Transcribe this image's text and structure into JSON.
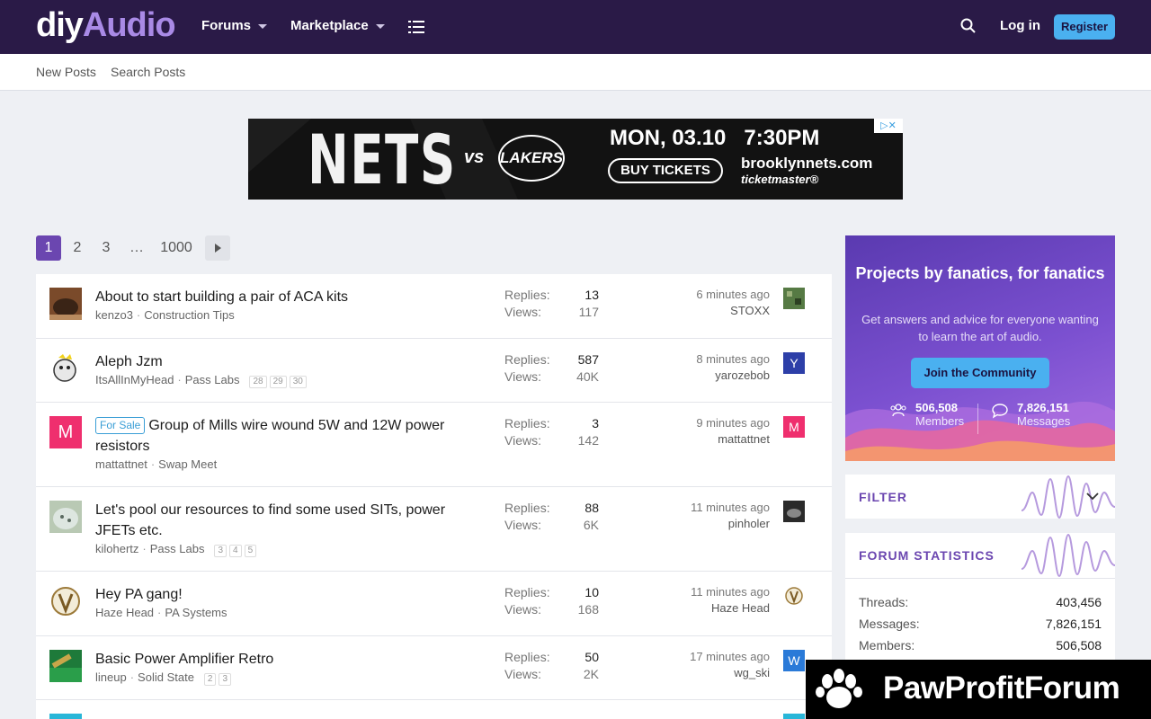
{
  "header": {
    "logo_part1": "diy",
    "logo_part2": "Audio",
    "nav": [
      "Forums",
      "Marketplace"
    ],
    "login": "Log in",
    "register": "Register"
  },
  "subnav": [
    "New Posts",
    "Search Posts"
  ],
  "ad": {
    "team": "NETS",
    "vs": "vs",
    "opponent": "LAKERS",
    "date": "MON, 03.10   7:30PM",
    "cta": "BUY TICKETS",
    "site": "brooklynnets.com",
    "vendor": "ticketmaster®"
  },
  "pagination": {
    "pages": [
      "1",
      "2",
      "3",
      "…",
      "1000"
    ],
    "current": "1"
  },
  "labels": {
    "replies": "Replies:",
    "views": "Views:"
  },
  "threads": [
    {
      "title": "About to start building a pair of ACA kits",
      "prefix": "",
      "author": "kenzo3",
      "forum": "Construction Tips",
      "pages": [],
      "replies": "13",
      "views": "117",
      "time": "6 minutes ago",
      "last_user": "STOXX",
      "last_avatar_letter": "",
      "avatar_letter": ""
    },
    {
      "title": "Aleph Jzm",
      "prefix": "",
      "author": "ItsAllInMyHead",
      "forum": "Pass Labs",
      "pages": [
        "28",
        "29",
        "30"
      ],
      "replies": "587",
      "views": "40K",
      "time": "8 minutes ago",
      "last_user": "yarozebob",
      "last_avatar_letter": "Y",
      "avatar_letter": ""
    },
    {
      "title": "Group of Mills wire wound 5W and 12W power resistors",
      "prefix": "For Sale",
      "author": "mattattnet",
      "forum": "Swap Meet",
      "pages": [],
      "replies": "3",
      "views": "142",
      "time": "9 minutes ago",
      "last_user": "mattattnet",
      "last_avatar_letter": "M",
      "avatar_letter": "M"
    },
    {
      "title": "Let's pool our resources to find some used SITs, power JFETs etc.",
      "prefix": "",
      "author": "kilohertz",
      "forum": "Pass Labs",
      "pages": [
        "3",
        "4",
        "5"
      ],
      "replies": "88",
      "views": "6K",
      "time": "11 minutes ago",
      "last_user": "pinholer",
      "last_avatar_letter": "",
      "avatar_letter": ""
    },
    {
      "title": "Hey PA gang!",
      "prefix": "",
      "author": "Haze Head",
      "forum": "PA Systems",
      "pages": [],
      "replies": "10",
      "views": "168",
      "time": "11 minutes ago",
      "last_user": "Haze Head",
      "last_avatar_letter": "",
      "avatar_letter": ""
    },
    {
      "title": "Basic Power Amplifier Retro",
      "prefix": "",
      "author": "lineup",
      "forum": "Solid State",
      "pages": [
        "2",
        "3"
      ],
      "replies": "50",
      "views": "2K",
      "time": "17 minutes ago",
      "last_user": "wg_ski",
      "last_avatar_letter": "W",
      "avatar_letter": ""
    }
  ],
  "promo": {
    "title": "Projects by fanatics, for fanatics",
    "text": "Get answers and advice for everyone wanting to learn the art of audio.",
    "cta": "Join the Community",
    "members_value": "506,508",
    "members_label": "Members",
    "messages_value": "7,826,151",
    "messages_label": "Messages"
  },
  "filter": {
    "title": "FILTER"
  },
  "forum_stats": {
    "title": "FORUM STATISTICS",
    "rows": [
      {
        "label": "Threads:",
        "value": "403,456"
      },
      {
        "label": "Messages:",
        "value": "7,826,151"
      },
      {
        "label": "Members:",
        "value": "506,508"
      }
    ]
  },
  "watermark": "PawProfitForum",
  "colors": {
    "header_bg": "#2a1a47",
    "accent": "#6b46b0",
    "button": "#4ab0f0"
  }
}
